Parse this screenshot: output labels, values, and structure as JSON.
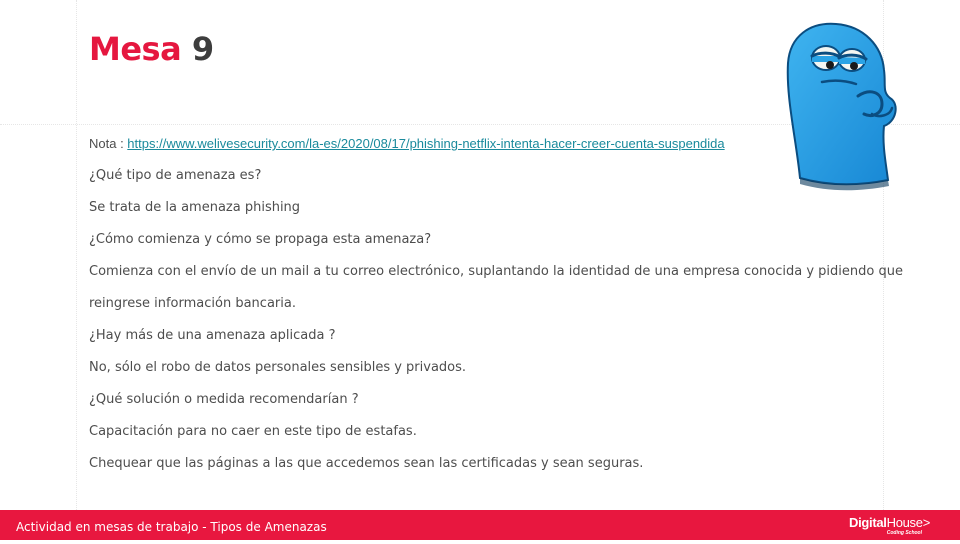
{
  "title": {
    "word": "Mesa",
    "number": "9"
  },
  "note": {
    "label": "Nota : ",
    "url": "https://www.welivesecurity.com/la-es/2020/08/17/phishing-netflix-intenta-hacer-creer-cuenta-suspendida"
  },
  "lines": [
    "¿Qué tipo de amenaza es?",
    "Se trata de la amenaza phishing",
    "¿Cómo comienza y cómo se propaga esta amenaza?",
    "Comienza con el envío de un mail a tu correo electrónico, suplantando la identidad de una empresa conocida y pidiendo que",
    "reingrese información bancaria.",
    "¿Hay más de una amenaza aplicada ?",
    "No, sólo el robo de datos personales sensibles y privados.",
    "¿Qué solución o medida recomendarían ?",
    "Capacitación para no caer en este tipo de estafas.",
    "Chequear que las páginas a las que accedemos sean las certificadas y sean seguras."
  ],
  "footer": {
    "text": "Actividad en mesas de trabajo - Tipos de Amenazas",
    "logo_bold": "Digital",
    "logo_light": "House",
    "logo_mark": ">",
    "logo_sub": "Coding School"
  },
  "colors": {
    "accent": "#e8173f",
    "link": "#1a8a9c",
    "mascot": "#2aa3e6"
  },
  "icons": {
    "mascot": "blue-mascot-illustration"
  }
}
